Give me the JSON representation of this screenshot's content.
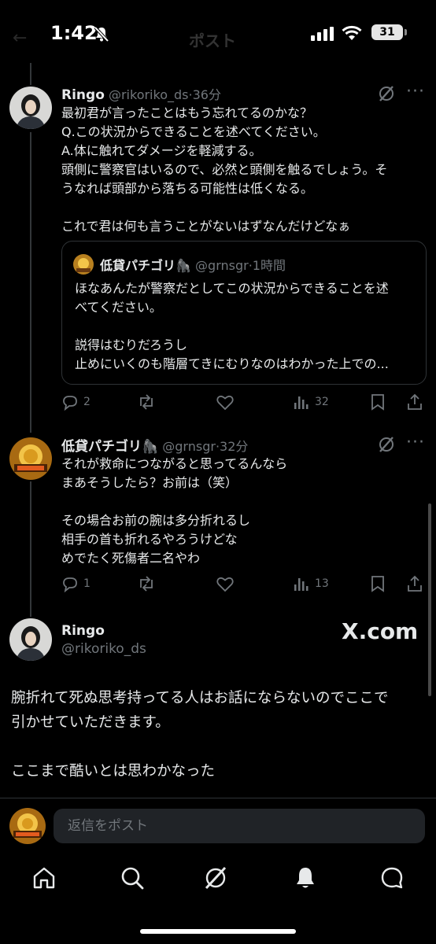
{
  "status": {
    "time": "1:42",
    "battery": "31"
  },
  "header": {
    "title": "ポスト"
  },
  "reply1": {
    "name": "Ringo",
    "handle": "@rikoriko_ds",
    "time": "36分",
    "text": "最初君が言ったことはもう忘れてるのかな？\nQ.この状況からできることを述べてください。\nA.体に触れてダメージを軽減する。\n頭側に警察官はいるので、必然と頭側を触るでしょう。そ\nうなれば頭部から落ちる可能性は低くなる。\n\nこれで君は何も言うことがないはずなんだけどなぁ",
    "quote": {
      "name": "低貸パチゴリ🦍",
      "handle": "@grnsgr",
      "time": "1時間",
      "text": "ほなあんたが警察だとしてこの状況からできることを述\nべてください。\n\n説得はむりだろうし\n止めにいくのも階層てきにむりなのはわかった上での..."
    },
    "replies": "2",
    "views": "32"
  },
  "reply2": {
    "name": "低貸パチゴリ🦍",
    "handle": "@grnsgr",
    "time": "32分",
    "text": "それが救命につながると思ってるんなら\nまあそうしたら？お前は（笑）\n\nその場合お前の腕は多分折れるし\n相手の首も折れるやろうけどな\nめでたく死傷者二名やわ",
    "replies": "1",
    "views": "13"
  },
  "main": {
    "name": "Ringo",
    "handle": "@rikoriko_ds",
    "watermark": "X.com",
    "text": "腕折れて死ぬ思考持ってる人はお話にならないのでここで\n引かせていただきます。\n\nここまで酷いとは思わかなった"
  },
  "reply_box": {
    "placeholder": "返信をポスト"
  },
  "colors": {
    "background": "#000000",
    "text": "#e7e9ea",
    "muted": "#71767b",
    "border": "#2f3336"
  }
}
